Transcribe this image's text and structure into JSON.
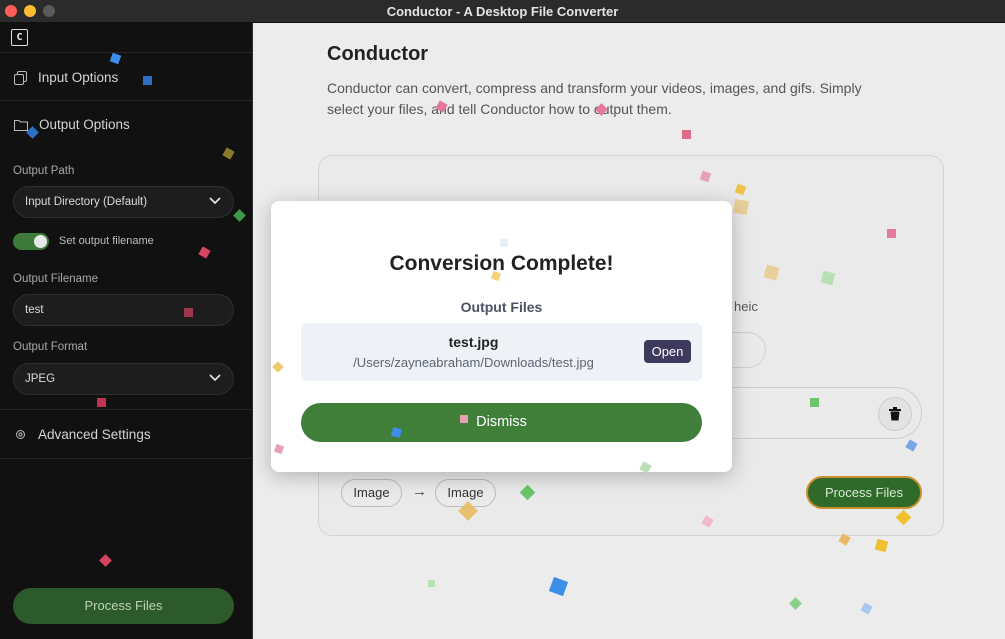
{
  "window": {
    "title": "Conductor - A Desktop File Converter"
  },
  "sidebar": {
    "logo": "C",
    "input_options": "Input Options",
    "output_options": "Output Options",
    "output_path_label": "Output Path",
    "output_path_value": "Input Directory (Default)",
    "set_filename_label": "Set output filename",
    "set_filename_on": true,
    "output_filename_label": "Output Filename",
    "output_filename_value": "test",
    "output_format_label": "Output Format",
    "output_format_value": "JPEG",
    "advanced_settings": "Advanced Settings",
    "process_button": "Process Files"
  },
  "main": {
    "title": "Conductor",
    "description": "Conductor can convert, compress and transform your videos, images, and gifs. Simply select your files, and tell Conductor how to output them.",
    "partial_text": "heic",
    "from_type": "Image",
    "to_type": "Image",
    "process_button": "Process Files"
  },
  "modal": {
    "title": "Conversion Complete!",
    "subtitle": "Output Files",
    "file_name": "test.jpg",
    "file_path": "/Users/zayneabraham/Downloads/test.jpg",
    "open_button": "Open",
    "dismiss_button": "Dismiss"
  },
  "colors": {
    "accent_green": "#3f7f3a",
    "open_button": "#3d3a5e",
    "sidebar_bg": "#111111"
  }
}
